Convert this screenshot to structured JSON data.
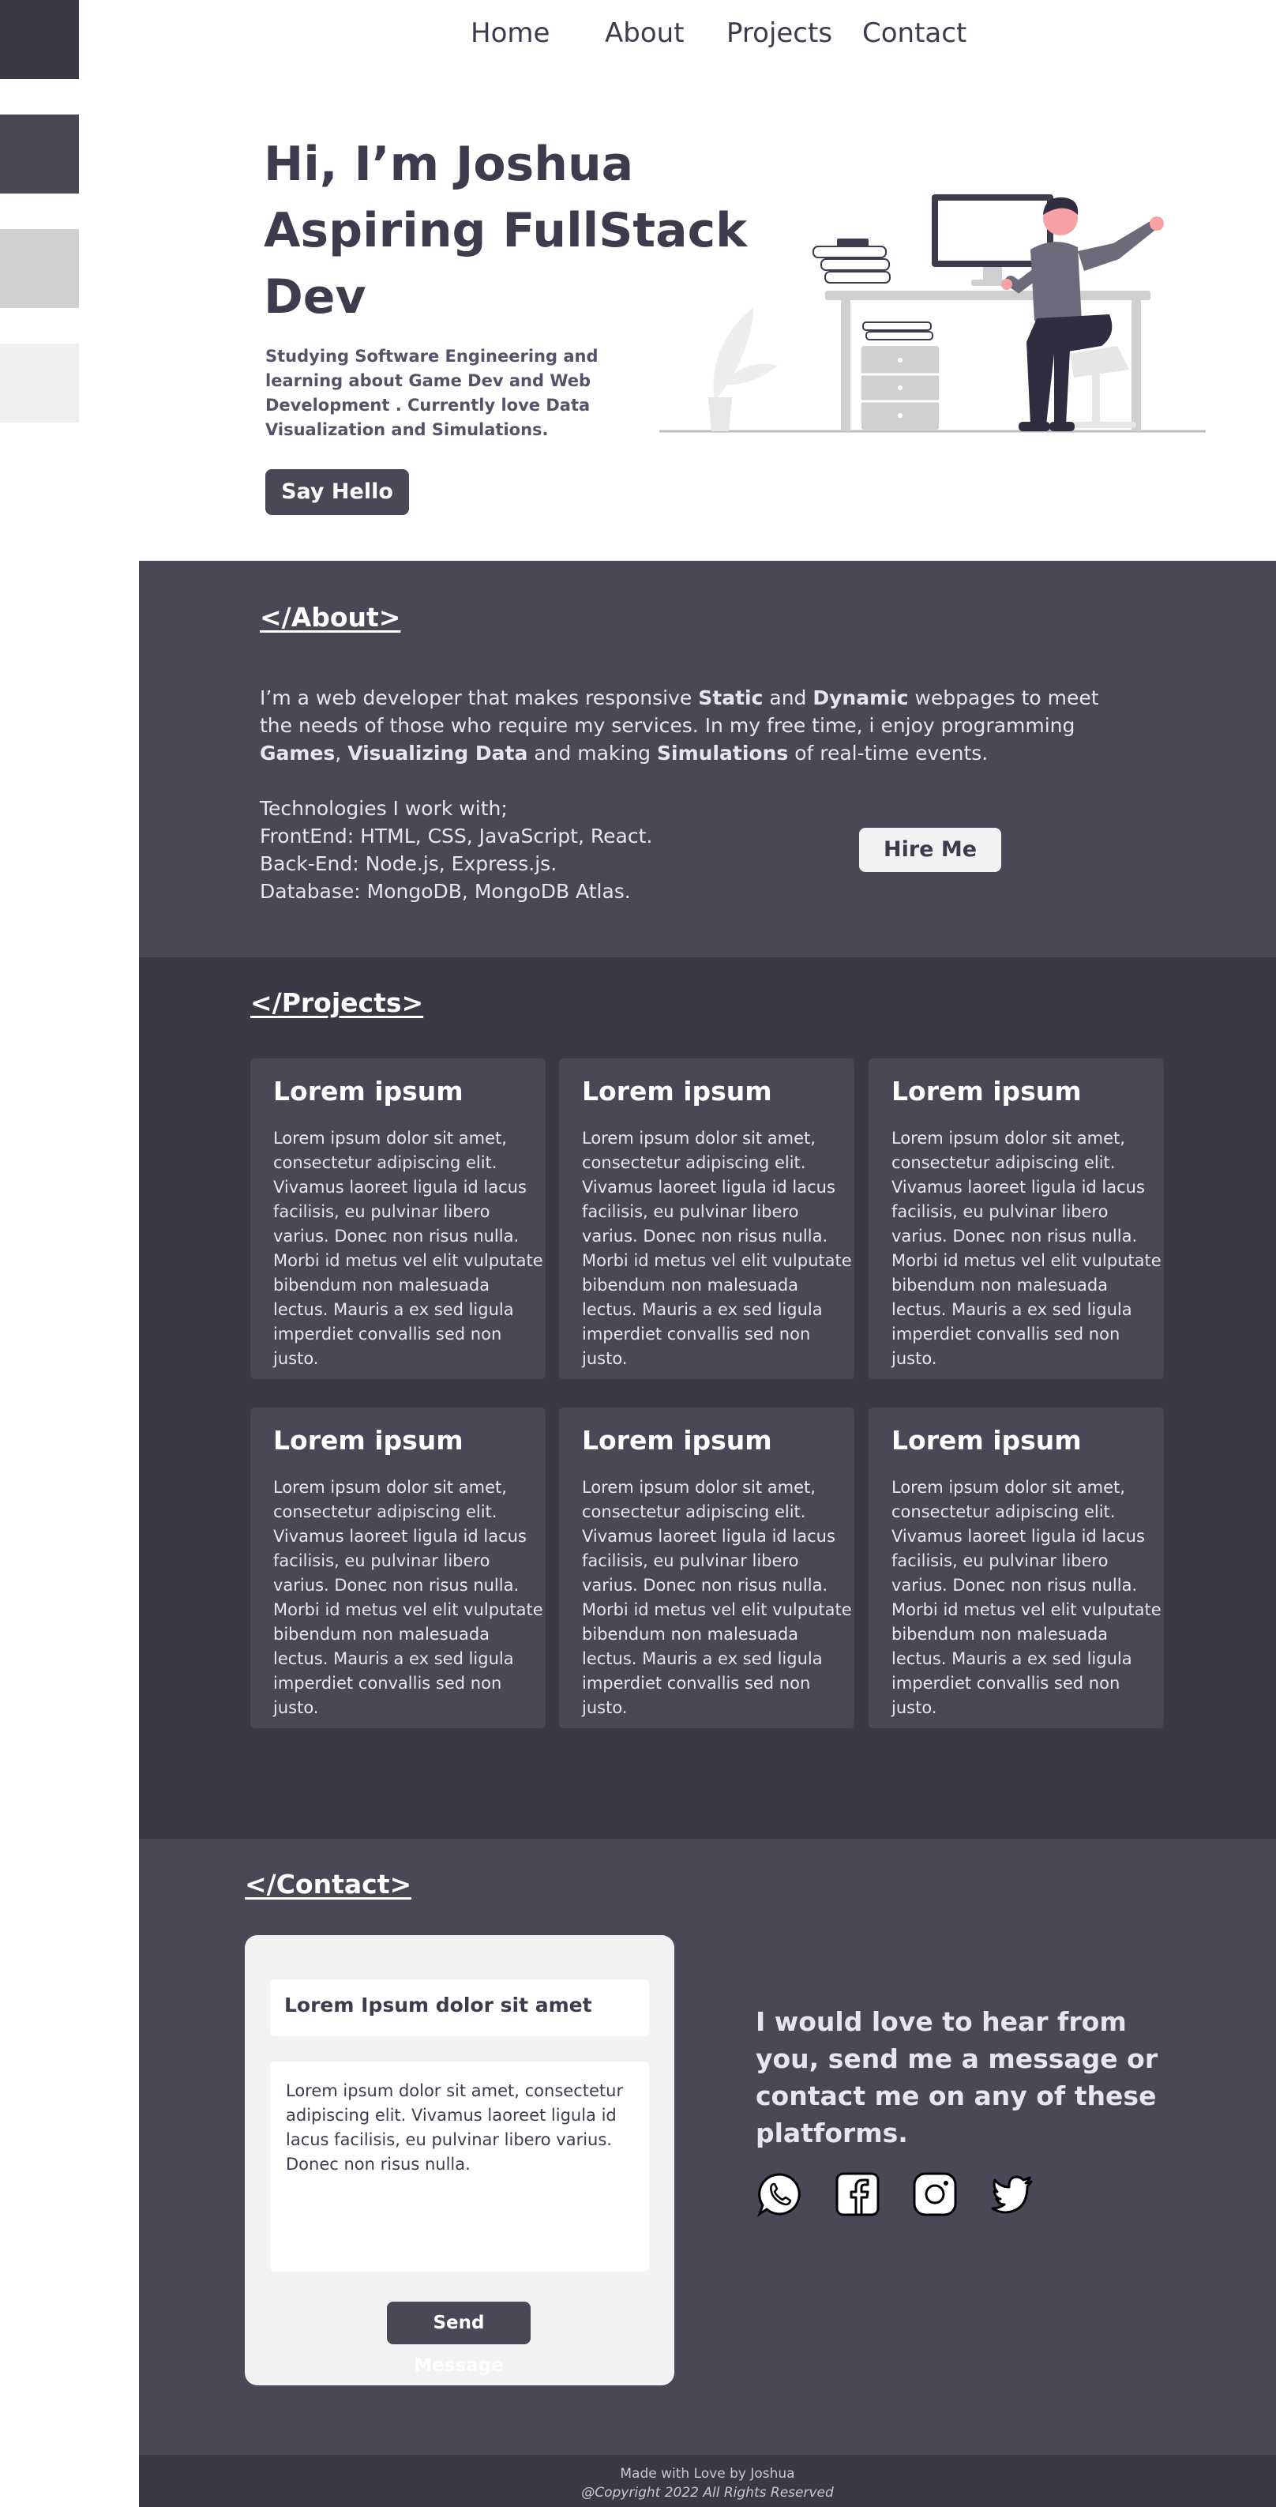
{
  "palette": {
    "swatches": [
      "#3b3945",
      "#4a4857",
      "#cfcfcf",
      "#efefef"
    ]
  },
  "nav": {
    "items": [
      "Home",
      "About",
      "Projects",
      "Contact"
    ]
  },
  "hero": {
    "title_lines": [
      "Hi, I’m Joshua",
      "Aspiring FullStack",
      "Dev"
    ],
    "subtitle": "Studying Software Engineering and learning about Game Dev and Web Development . Currently love Data Visualization and Simulations.",
    "cta_label": "Say Hello",
    "illustration": "person-at-desk-illustration"
  },
  "about": {
    "heading": "</About>",
    "intro_parts": [
      {
        "text": "I’m a web developer that makes responsive ",
        "bold": false
      },
      {
        "text": "Static",
        "bold": true
      },
      {
        "text": " and ",
        "bold": false
      },
      {
        "text": "Dynamic",
        "bold": true
      },
      {
        "text": " webpages to meet the needs of those who require my services. In my free time, i enjoy programming ",
        "bold": false
      },
      {
        "text": "Games",
        "bold": true
      },
      {
        "text": ", ",
        "bold": false
      },
      {
        "text": "Visualizing Data",
        "bold": true
      },
      {
        "text": " and making ",
        "bold": false
      },
      {
        "text": "Simulations",
        "bold": true
      },
      {
        "text": " of real-time events.",
        "bold": false
      }
    ],
    "tech_lines": [
      "Technologies I work with;",
      "FrontEnd: HTML, CSS,  JavaScript, React.",
      "Back-End: Node.js, Express.js.",
      "Database: MongoDB, MongoDB Atlas."
    ],
    "hire_label": "Hire Me"
  },
  "projects": {
    "heading": "</Projects>",
    "cards": [
      {
        "title": "Lorem ipsum",
        "body": "Lorem ipsum dolor sit amet, consectetur adipiscing elit. Vivamus laoreet ligula id lacus facilisis, eu pulvinar libero varius. Donec non risus nulla. Morbi id metus vel elit vulputate bibendum non malesuada lectus. Mauris a ex sed ligula imperdiet convallis sed non justo."
      },
      {
        "title": "Lorem ipsum",
        "body": "Lorem ipsum dolor sit amet, consectetur adipiscing elit. Vivamus laoreet ligula id lacus facilisis, eu pulvinar libero varius. Donec non risus nulla. Morbi id metus vel elit vulputate bibendum non malesuada lectus. Mauris a ex sed ligula imperdiet convallis sed non justo."
      },
      {
        "title": "Lorem ipsum",
        "body": "Lorem ipsum dolor sit amet, consectetur adipiscing elit. Vivamus laoreet ligula id lacus facilisis, eu pulvinar libero varius. Donec non risus nulla. Morbi id metus vel elit vulputate bibendum non malesuada lectus. Mauris a ex sed ligula imperdiet convallis sed non justo."
      },
      {
        "title": "Lorem ipsum",
        "body": "Lorem ipsum dolor sit amet, consectetur adipiscing elit. Vivamus laoreet ligula id lacus facilisis, eu pulvinar libero varius. Donec non risus nulla. Morbi id metus vel elit vulputate bibendum non malesuada lectus. Mauris a ex sed ligula imperdiet convallis sed non justo."
      },
      {
        "title": "Lorem ipsum",
        "body": "Lorem ipsum dolor sit amet, consectetur adipiscing elit. Vivamus laoreet ligula id lacus facilisis, eu pulvinar libero varius. Donec non risus nulla. Morbi id metus vel elit vulputate bibendum non malesuada lectus. Mauris a ex sed ligula imperdiet convallis sed non justo."
      },
      {
        "title": "Lorem ipsum",
        "body": "Lorem ipsum dolor sit amet, consectetur adipiscing elit. Vivamus laoreet ligula id lacus facilisis, eu pulvinar libero varius. Donec non risus nulla. Morbi id metus vel elit vulputate bibendum non malesuada lectus. Mauris a ex sed ligula imperdiet convallis sed non justo."
      }
    ]
  },
  "contact": {
    "heading": "</Contact>",
    "subject_value": "Lorem Ipsum dolor sit amet",
    "message_value": "Lorem ipsum dolor sit amet, consectetur adipiscing elit. Vivamus laoreet ligula id lacus facilisis, eu pulvinar libero varius. Donec non risus nulla.",
    "send_label": "Send Message",
    "prompt": "I would love to hear from you, send me a message or contact me on any of these platforms.",
    "socials": [
      "whatsapp-icon",
      "facebook-icon",
      "instagram-icon",
      "twitter-icon"
    ]
  },
  "footer": {
    "made_with": "Made with Love by Joshua",
    "copyright": "@Copyright 2022 All Rights Reserved"
  }
}
